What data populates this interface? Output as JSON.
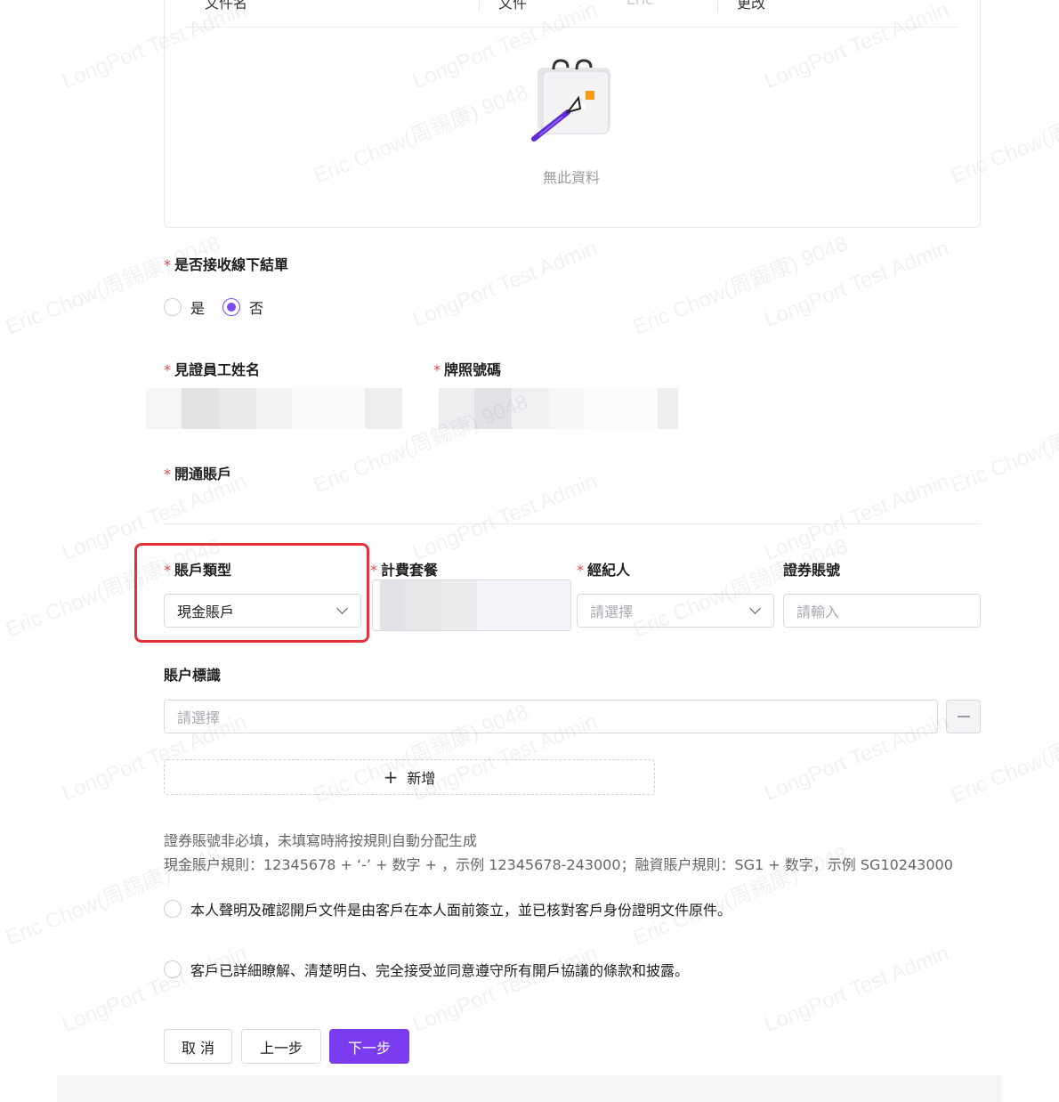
{
  "table": {
    "headers": [
      "文件名",
      "文件",
      "Eric",
      "更改"
    ],
    "empty_text": "無此資料",
    "empty_icon": "empty-notebook-icon"
  },
  "offline_settlement": {
    "label": "是否接收線下結單",
    "required": "*",
    "options": [
      {
        "label": "是",
        "checked": false
      },
      {
        "label": "否",
        "checked": true
      }
    ]
  },
  "witness": {
    "name_label": "見證員工姓名",
    "license_label": "牌照號碼"
  },
  "open_account": {
    "label": "開通賬戶"
  },
  "account_type": {
    "label": "賬戶類型",
    "value": "現金賬戶"
  },
  "fee_package": {
    "label": "計費套餐"
  },
  "broker": {
    "label": "經紀人",
    "placeholder": "請選擇"
  },
  "securities_account": {
    "label": "證券賬號",
    "placeholder": "請輸入"
  },
  "account_tag": {
    "label": "賬户標識",
    "placeholder": "請選擇"
  },
  "add_button": {
    "icon": "+",
    "label": "新增"
  },
  "notes": {
    "line1": "證券賬號非必填，未填寫時將按規則自動分配生成",
    "line2": "現金賬户規則：12345678 + ‘-’ + 数字 + ，示例 12345678-243000；融資賬户規則：SG1 + 数字，示例 SG10243000"
  },
  "declarations": [
    "本人聲明及確認開戶文件是由客戶在本人面前簽立，並已核對客戶身份證明文件原件。",
    "客戶已詳細瞭解、清楚明白、完全接受並同意遵守所有開戶協議的條款和披露。"
  ],
  "buttons": {
    "cancel": "取 消",
    "prev": "上一步",
    "next": "下一步"
  },
  "watermark": {
    "line_a": "LongPort Test Admin",
    "line_b": "Eric Chow(周錫康) 9048"
  },
  "colors": {
    "primary": "#7b3cf0",
    "required": "#e5484d",
    "highlight": "#e5303a"
  }
}
